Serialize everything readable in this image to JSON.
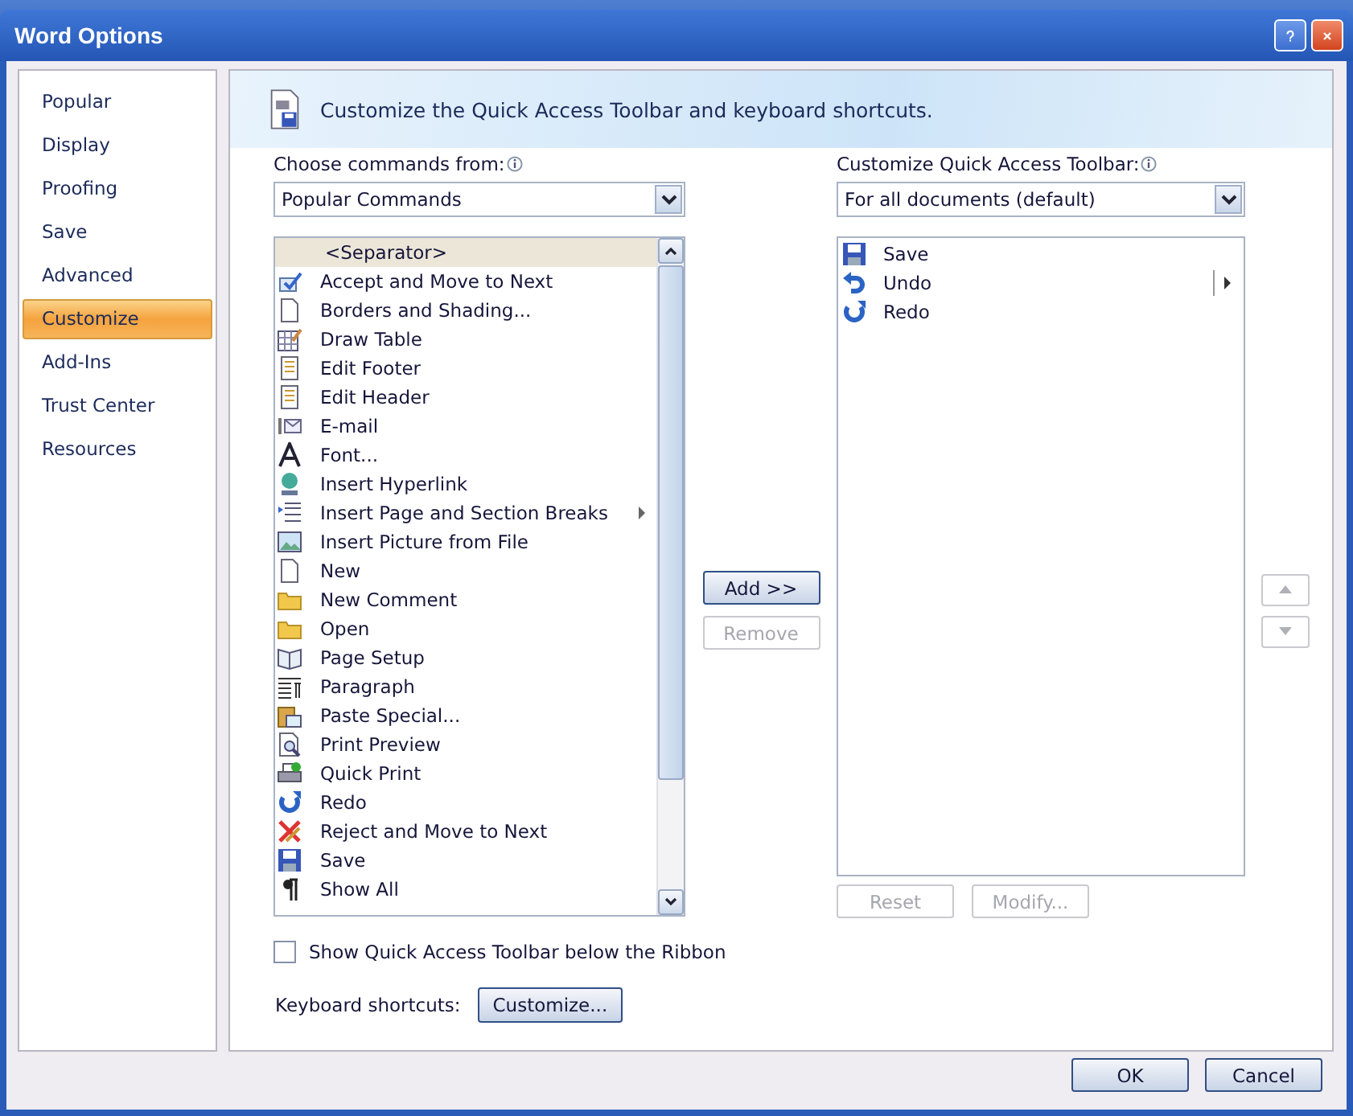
{
  "window": {
    "title": "Word Options"
  },
  "sidebar": {
    "items": [
      {
        "label": "Popular",
        "selected": false
      },
      {
        "label": "Display",
        "selected": false
      },
      {
        "label": "Proofing",
        "selected": false
      },
      {
        "label": "Save",
        "selected": false
      },
      {
        "label": "Advanced",
        "selected": false
      },
      {
        "label": "Customize",
        "selected": true
      },
      {
        "label": "Add-Ins",
        "selected": false
      },
      {
        "label": "Trust Center",
        "selected": false
      },
      {
        "label": "Resources",
        "selected": false
      }
    ]
  },
  "header": {
    "title": "Customize the Quick Access Toolbar and keyboard shortcuts."
  },
  "commands_from": {
    "label": "Choose commands from:",
    "value": "Popular Commands"
  },
  "toolbar_for": {
    "label": "Customize Quick Access Toolbar:",
    "value": "For all documents (default)"
  },
  "commands": [
    {
      "label": "<Separator>",
      "selected": true,
      "submenu": false
    },
    {
      "label": "Accept and Move to Next",
      "selected": false,
      "submenu": false
    },
    {
      "label": "Borders and Shading...",
      "selected": false,
      "submenu": false
    },
    {
      "label": "Draw Table",
      "selected": false,
      "submenu": false
    },
    {
      "label": "Edit Footer",
      "selected": false,
      "submenu": false
    },
    {
      "label": "Edit Header",
      "selected": false,
      "submenu": false
    },
    {
      "label": "E-mail",
      "selected": false,
      "submenu": false
    },
    {
      "label": "Font...",
      "selected": false,
      "submenu": false
    },
    {
      "label": "Insert Hyperlink",
      "selected": false,
      "submenu": false
    },
    {
      "label": "Insert Page and Section Breaks",
      "selected": false,
      "submenu": true
    },
    {
      "label": "Insert Picture from File",
      "selected": false,
      "submenu": false
    },
    {
      "label": "New",
      "selected": false,
      "submenu": false
    },
    {
      "label": "New Comment",
      "selected": false,
      "submenu": false
    },
    {
      "label": "Open",
      "selected": false,
      "submenu": false
    },
    {
      "label": "Page Setup",
      "selected": false,
      "submenu": false
    },
    {
      "label": "Paragraph",
      "selected": false,
      "submenu": false
    },
    {
      "label": "Paste Special...",
      "selected": false,
      "submenu": false
    },
    {
      "label": "Print Preview",
      "selected": false,
      "submenu": false
    },
    {
      "label": "Quick Print",
      "selected": false,
      "submenu": false
    },
    {
      "label": "Redo",
      "selected": false,
      "submenu": false
    },
    {
      "label": "Reject and Move to Next",
      "selected": false,
      "submenu": false
    },
    {
      "label": "Save",
      "selected": false,
      "submenu": false
    },
    {
      "label": "Show All",
      "selected": false,
      "submenu": false
    }
  ],
  "toolbar_items": [
    {
      "label": "Save",
      "submenu": false
    },
    {
      "label": "Undo",
      "submenu": true
    },
    {
      "label": "Redo",
      "submenu": false
    }
  ],
  "add_button": {
    "label": "Add >>",
    "disabled": false
  },
  "remove_button": {
    "label": "Remove",
    "disabled": true
  },
  "reset_button": {
    "label": "Reset",
    "disabled": true
  },
  "modify_button": {
    "label": "Modify...",
    "disabled": true
  },
  "below_ribbon": {
    "label": "Show Quick Access Toolbar below the Ribbon",
    "checked": false
  },
  "keyboard": {
    "label": "Keyboard shortcuts:",
    "button": "Customize..."
  },
  "footer": {
    "buttons": [
      "OK",
      "Cancel"
    ]
  }
}
